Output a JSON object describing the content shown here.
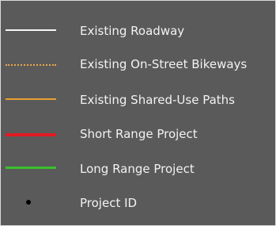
{
  "legend": {
    "background_color": "#5a5a5a",
    "items": [
      {
        "label": "Existing Roadway",
        "symbol": "solid-line",
        "color": "#f5f5f5"
      },
      {
        "label": "Existing On-Street Bikeways",
        "symbol": "dotted-line",
        "color": "#e8a64a"
      },
      {
        "label": "Existing Shared-Use Paths",
        "symbol": "solid-line",
        "color": "#e8a030"
      },
      {
        "label": "Short Range Project",
        "symbol": "thick-line",
        "color": "#e01b24"
      },
      {
        "label": "Long Range Project",
        "symbol": "solid-line",
        "color": "#3bbf2e"
      },
      {
        "label": "Project ID",
        "symbol": "dot",
        "color": "#000000"
      }
    ]
  }
}
